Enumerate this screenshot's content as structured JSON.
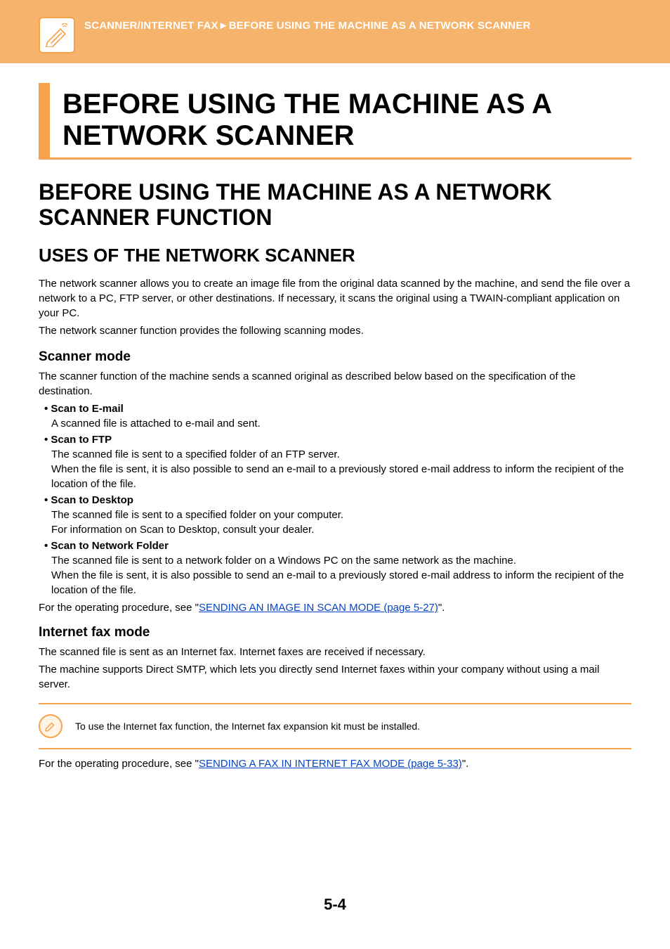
{
  "header": {
    "breadcrumb_left": "SCANNER/INTERNET FAX",
    "breadcrumb_sep": "►",
    "breadcrumb_right": "BEFORE USING THE MACHINE AS A NETWORK SCANNER"
  },
  "titles": {
    "h1": "BEFORE USING THE MACHINE AS A NETWORK SCANNER",
    "h2": "BEFORE USING THE MACHINE AS A NETWORK SCANNER FUNCTION",
    "h3": "USES OF THE NETWORK SCANNER"
  },
  "intro": {
    "p1": "The network scanner allows you to create an image file from the original data scanned by the machine, and send the file over a network to a PC, FTP server, or other destinations. If necessary, it scans the original using a TWAIN-compliant application on your PC.",
    "p2": "The network scanner function provides the following scanning modes."
  },
  "scanner_mode": {
    "heading": "Scanner mode",
    "intro": "The scanner function of the machine sends a scanned original as described below based on the specification of the destination.",
    "items": [
      {
        "title": "Scan to E-mail",
        "body": "A scanned file is attached to e-mail and sent."
      },
      {
        "title": "Scan to FTP",
        "body": "The scanned file is sent to a specified folder of an FTP server.\nWhen the file is sent, it is also possible to send an e-mail to a previously stored e-mail address to inform the recipient of the location of the file."
      },
      {
        "title": "Scan to Desktop",
        "body": "The scanned file is sent to a specified folder on your computer.\nFor information on Scan to Desktop, consult your dealer."
      },
      {
        "title": "Scan to Network Folder",
        "body": "The scanned file is sent to a network folder on a Windows PC on the same network as the machine.\nWhen the file is sent, it is also possible to send an e-mail to a previously stored e-mail address to inform the recipient of the location of the file."
      }
    ],
    "ref_prefix": "For the operating procedure, see \"",
    "ref_link": "SENDING AN IMAGE IN SCAN MODE (page 5-27)",
    "ref_suffix": "\"."
  },
  "ifax_mode": {
    "heading": "Internet fax mode",
    "p1": "The scanned file is sent as an Internet fax. Internet faxes are received if necessary.",
    "p2": "The machine supports Direct SMTP, which lets you directly send Internet faxes within your company without using a mail server.",
    "note": "To use the Internet fax function, the Internet fax expansion kit must be installed.",
    "ref_prefix": "For the operating procedure, see \"",
    "ref_link": "SENDING A FAX IN INTERNET FAX MODE (page 5-33)",
    "ref_suffix": "\"."
  },
  "page_number": "5-4"
}
